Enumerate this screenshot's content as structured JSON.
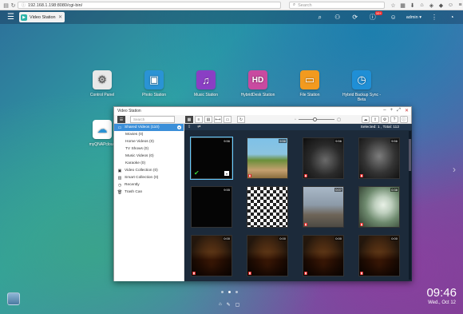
{
  "browser": {
    "url": "192.168.1.198:8080/cgi-bin/",
    "search_placeholder": "Search"
  },
  "qts_bar": {
    "app_tab_label": "Video Station",
    "notification_count": "10+",
    "user": "admin ▾"
  },
  "desktop": {
    "icons": [
      {
        "label": "Control Panel",
        "color": "#e8e8e8",
        "icon": "gear-icon"
      },
      {
        "label": "Photo Station",
        "color": "#2a93d5",
        "icon": "photo-icon"
      },
      {
        "label": "Music Station",
        "color": "#8a3fc4",
        "icon": "music-icon"
      },
      {
        "label": "HybridDesk Station",
        "color": "#c94aa0",
        "icon": "hd-icon"
      },
      {
        "label": "File Station",
        "color": "#f29a1f",
        "icon": "folder-icon"
      },
      {
        "label": "Hybrid Backup Sync - Beta",
        "color": "#1f8fd6",
        "icon": "backup-icon"
      },
      {
        "label": "myQNAPcloud",
        "color": "#ffffff",
        "icon": "cloud-icon"
      }
    ]
  },
  "video_station": {
    "title": "Video Station",
    "search_placeholder": "Search",
    "selection": "Selected: 1 , Total: 112",
    "sidebar": [
      {
        "label": "Shared Videos (110)",
        "active": true,
        "sub": false
      },
      {
        "label": "Movies (0)",
        "active": false,
        "sub": true
      },
      {
        "label": "Home Videos (0)",
        "active": false,
        "sub": true
      },
      {
        "label": "TV Shows (0)",
        "active": false,
        "sub": true
      },
      {
        "label": "Music Videos (0)",
        "active": false,
        "sub": true
      },
      {
        "label": "Karaoke (0)",
        "active": false,
        "sub": true
      },
      {
        "label": "Video Collection (0)",
        "active": false,
        "sub": false
      },
      {
        "label": "Smart Collection (0)",
        "active": false,
        "sub": false
      },
      {
        "label": "Recently",
        "active": false,
        "sub": false
      },
      {
        "label": "Trash Can",
        "active": false,
        "sub": false
      }
    ],
    "thumbnails": [
      {
        "duration": "9:56",
        "style": "t-black",
        "hd": false,
        "selected": true
      },
      {
        "duration": "9:56",
        "style": "t-lego",
        "hd": true,
        "selected": false
      },
      {
        "duration": "9:56",
        "style": "t-dark1",
        "hd": true,
        "selected": false
      },
      {
        "duration": "9:56",
        "style": "t-dark2",
        "hd": true,
        "selected": false
      },
      {
        "duration": "9:55",
        "style": "t-black",
        "hd": false,
        "selected": false
      },
      {
        "duration": "",
        "style": "t-checker",
        "hd": false,
        "selected": false
      },
      {
        "duration": "0:07",
        "style": "t-street",
        "hd": true,
        "selected": false
      },
      {
        "duration": "0:38",
        "style": "t-disc",
        "hd": true,
        "selected": false
      },
      {
        "duration": "0:00",
        "style": "t-leaves",
        "hd": true,
        "selected": false
      },
      {
        "duration": "0:00",
        "style": "t-leaves",
        "hd": true,
        "selected": false
      },
      {
        "duration": "0:00",
        "style": "t-leaves",
        "hd": true,
        "selected": false
      },
      {
        "duration": "0:00",
        "style": "t-leaves",
        "hd": true,
        "selected": false
      }
    ]
  },
  "clock": {
    "time": "09:46",
    "date": "Wed., Oct 12"
  }
}
